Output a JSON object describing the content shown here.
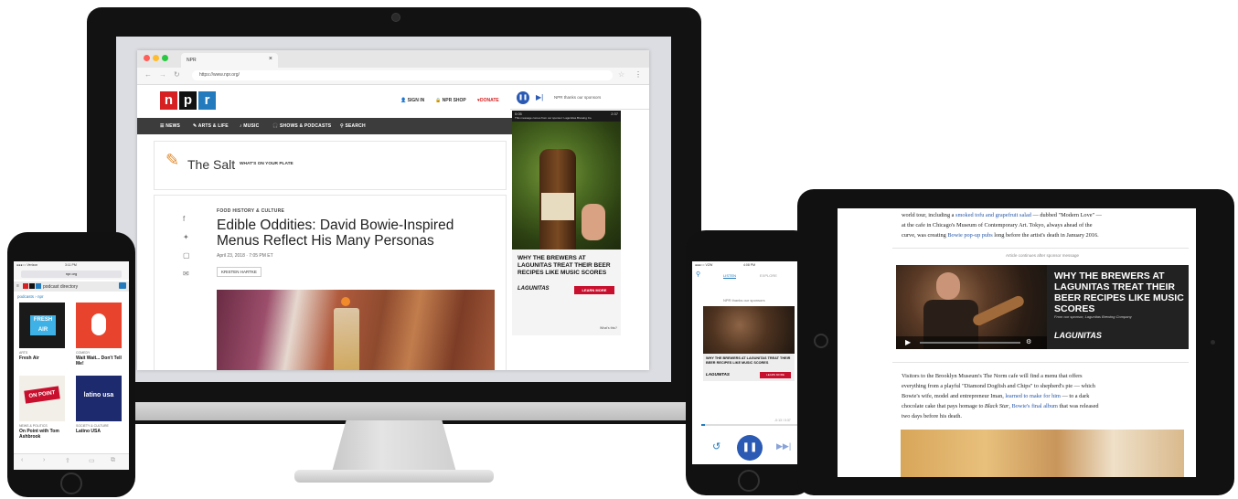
{
  "desktop": {
    "tab_title": "NPR",
    "tab_close": "×",
    "url": "https://www.npr.org/",
    "logo_letters": [
      "n",
      "p",
      "r"
    ],
    "utility_nav": [
      "SIGN IN",
      "NPR SHOP",
      "DONATE"
    ],
    "main_nav": [
      "NEWS",
      "ARTS & LIFE",
      "MUSIC",
      "SHOWS & PODCASTS",
      "SEARCH"
    ],
    "blog_name": "The Salt",
    "blog_tagline": "WHAT'S ON YOUR PLATE",
    "article": {
      "kicker": "FOOD HISTORY & CULTURE",
      "headline": "Edible Oddities: David Bowie-Inspired Menus Reflect His Many Personas",
      "date": "April 23, 2018 · 7:05 PM ET",
      "byline": "KRISTEN HARTKE"
    },
    "player": {
      "sponsor_text": "NPR thanks our sponsors"
    },
    "ad": {
      "top_left": "0:05",
      "top_right": "2:37",
      "top_text": "This message comes from our sponsor: Laguinitas Brewing Co.",
      "headline": "WHY THE BREWERS AT LAGUNITAS TREAT THEIR BEER RECIPES LIKE MUSIC SCORES",
      "brand": "LAGUNITAS",
      "cta": "LEARN MORE",
      "footer": "What's this?"
    },
    "colors": {
      "npr_red": "#d62021",
      "npr_black": "#111111",
      "npr_blue": "#237bbd",
      "nav_bg": "#3c3c3c",
      "accent_blue": "#2a5ab4"
    }
  },
  "phone_left": {
    "status_left": "●●●○○ Verizon",
    "status_time": "3:11 PM",
    "url": "npr.org",
    "header": "podcast directory",
    "breadcrumb": "podcasts › npr",
    "podcasts": [
      {
        "title": "Fresh Air",
        "category": "ARTS",
        "art_text": "FRESH AIR"
      },
      {
        "title": "Wait Wait... Don't Tell Me!",
        "category": "COMEDY",
        "art_text": ""
      },
      {
        "title": "On Point with Tom Ashbrook",
        "category": "NEWS & POLITICS",
        "art_text": "ON POINT"
      },
      {
        "title": "Latino USA",
        "category": "SOCIETY & CULTURE",
        "art_text": "latino usa"
      }
    ]
  },
  "phone_right": {
    "status_left": "●●●○○ VZW",
    "status_time": "4:08 PM",
    "tabs": [
      "LISTEN",
      "EXPLORE"
    ],
    "sponsor_text": "NPR thanks our sponsors",
    "ad_headline": "WHY THE BREWERS AT LAGUNITAS TREAT THEIR BEER RECIPES LIKE MUSIC SCORES",
    "brand": "LAGUNITAS",
    "cta": "LEARN MORE",
    "progress_time": "-0:13 / 0:37"
  },
  "tablet": {
    "para1_line1_pre": "world tour, including a ",
    "para1_link1": "smoked tofu and grapefruit salad",
    "para1_line1_post": " — dubbed \"Modern Love\" —",
    "para1_line2": "at the cafe in Chicago's Museum of Contemporary Art. Tokyo, always ahead of the",
    "para1_line3_pre": "curve, was creating ",
    "para1_link2": "Bowie pop-up pubs",
    "para1_line3_post": " long before the artist's death in January 2016.",
    "sponsor_label": "Article continues after sponsor message",
    "video_headline": "WHY THE BREWERS AT LAGUNITAS TREAT THEIR BEER RECIPES LIKE MUSIC SCORES",
    "video_sub": "From our sponsor, Lagunitas Brewing Company",
    "video_brand": "LAGUNITAS",
    "para2_line1": "Visitors to the Brooklyn Museum's The Norm cafe will find a menu that offers",
    "para2_line2": "everything from a playful \"Diamond Dogfish and Chips\" to shepherd's pie — which",
    "para2_line3_pre": "Bowie's wife, model and entrepreneur Iman, ",
    "para2_link1": "learned to make for him",
    "para2_line3_post": " — to a dark",
    "para2_line4_pre": "chocolate cake that pays homage to ",
    "para2_italic": "Black Star",
    "para2_line4_mid": ", ",
    "para2_link2": "Bowie's final album",
    "para2_line4_post": " that was released",
    "para2_line5": "two days before his death."
  }
}
